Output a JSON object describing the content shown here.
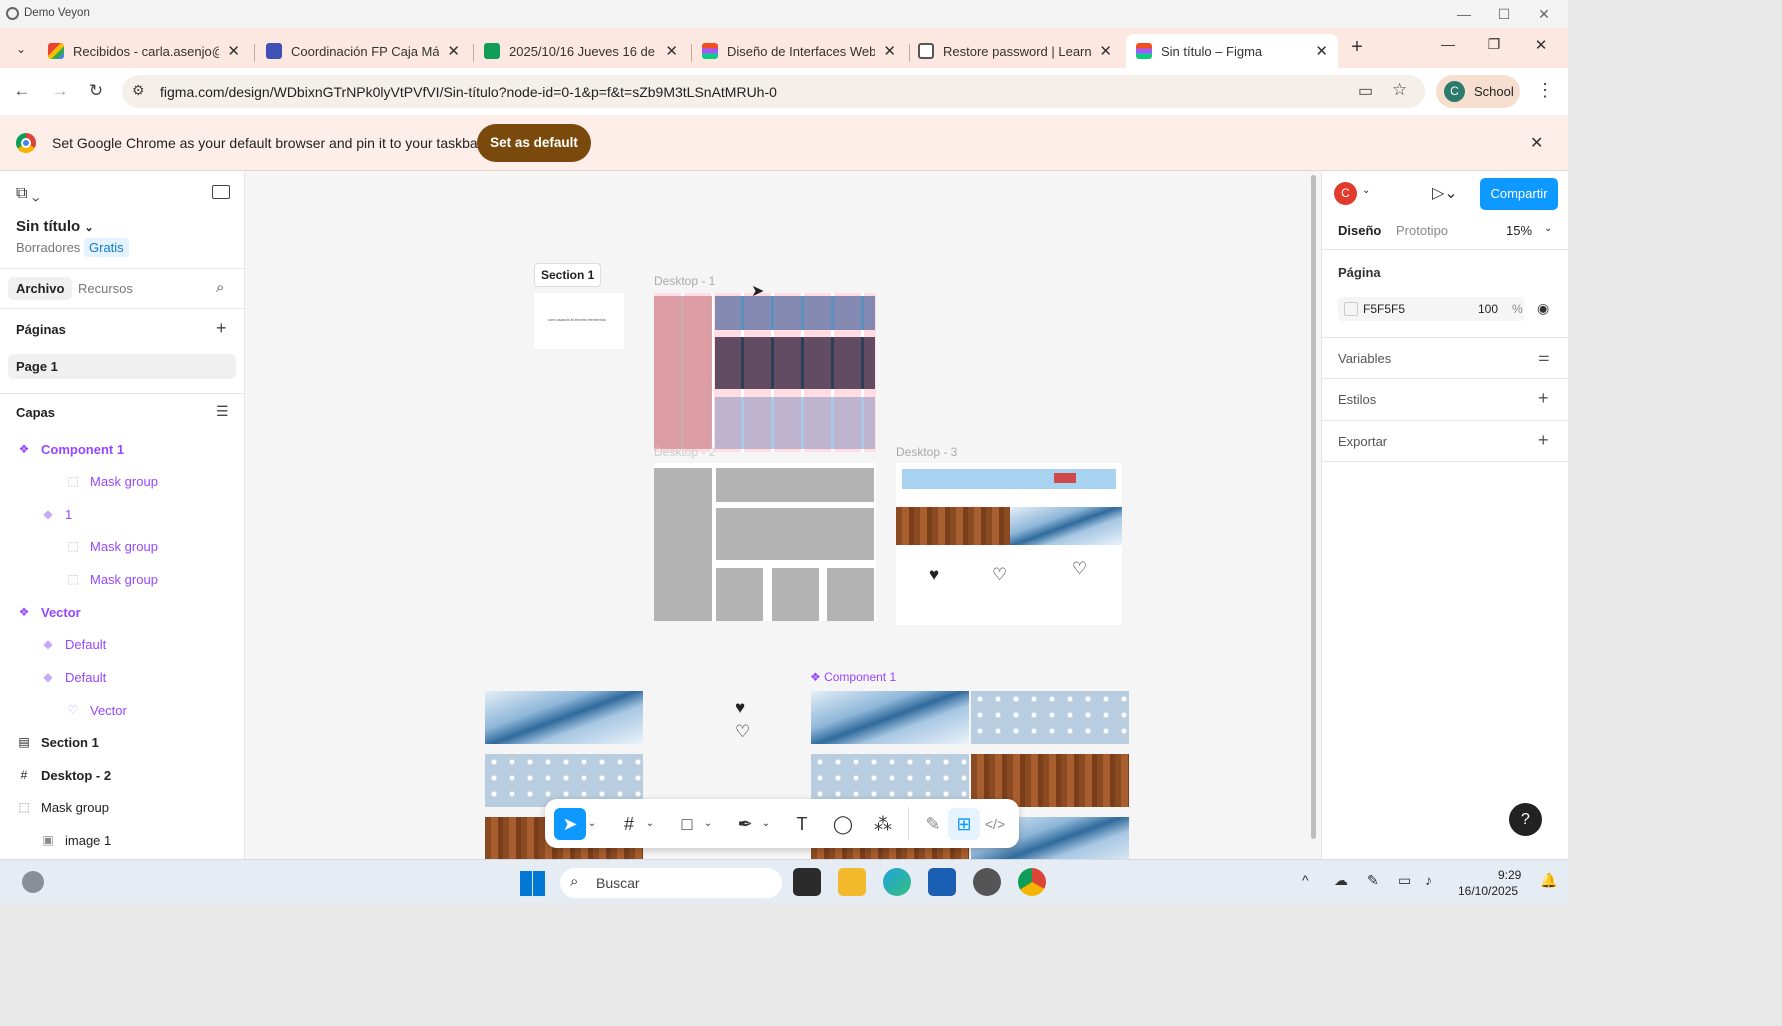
{
  "window": {
    "title": "Demo Veyon"
  },
  "tabs": [
    {
      "label": "Recibidos - carla.asenjo@e",
      "icon": "gmail-icon",
      "color": "#ea4335"
    },
    {
      "label": "Coordinación FP Caja Mág",
      "icon": "forms-icon",
      "color": "#3f51b5"
    },
    {
      "label": "2025/10/16 Jueves 16 de o",
      "icon": "sheets-icon",
      "color": "#0f9d58"
    },
    {
      "label": "Diseño de Interfaces Web -",
      "icon": "figma-icon",
      "color": "#f24e1e"
    },
    {
      "label": "Restore password | Learnin",
      "icon": "page-icon",
      "color": "#555555"
    },
    {
      "label": "Sin título – Figma",
      "icon": "figma-icon",
      "color": "#f24e1e"
    }
  ],
  "address": {
    "url": "figma.com/design/WDbixnGTrNPk0lyVtPVfVI/Sin-título?node-id=0-1&p=f&t=sZb9M3tLSnAtMRUh-0"
  },
  "profile": {
    "initial": "C",
    "name": "School"
  },
  "infobar": {
    "message": "Set Google Chrome as your default browser and pin it to your taskbar",
    "button": "Set as default"
  },
  "left": {
    "file_title": "Sin título",
    "drafts": "Borradores",
    "plan": "Gratis",
    "tab_file": "Archivo",
    "tab_assets": "Recursos",
    "pages_heading": "Páginas",
    "page1": "Page 1",
    "layers_heading": "Capas",
    "layers": [
      {
        "label": "Component 1",
        "icon": "component-icon"
      },
      {
        "label": "Mask group",
        "icon": "mask-icon"
      },
      {
        "label": "1",
        "icon": "instance-icon"
      },
      {
        "label": "Mask group",
        "icon": "mask-icon"
      },
      {
        "label": "Mask group",
        "icon": "mask-icon"
      },
      {
        "label": "Vector",
        "icon": "component-icon"
      },
      {
        "label": "Default",
        "icon": "instance-icon"
      },
      {
        "label": "Default",
        "icon": "instance-icon"
      },
      {
        "label": "Vector",
        "icon": "heart-icon"
      },
      {
        "label": "Section 1",
        "icon": "section-icon"
      },
      {
        "label": "Desktop - 2",
        "icon": "frame-icon"
      },
      {
        "label": "Mask group",
        "icon": "mask-icon"
      },
      {
        "label": "image 1",
        "icon": "image-icon"
      }
    ]
  },
  "canvas": {
    "section_label": "Section 1",
    "section_text": "com.usando.el.theme.elementos",
    "desktop1": "Desktop - 1",
    "desktop2": "Desktop - 2",
    "desktop3": "Desktop - 3",
    "component_label": "Component 1"
  },
  "right": {
    "avatar_initial": "C",
    "share": "Compartir",
    "tab_design": "Diseño",
    "tab_prototype": "Prototipo",
    "zoom": "15%",
    "page_heading": "Página",
    "page_color": "F5F5F5",
    "page_opacity": "100",
    "percent": "%",
    "variables": "Variables",
    "styles": "Estilos",
    "export": "Exportar"
  },
  "taskbar": {
    "search": "Buscar",
    "time": "9:29",
    "date": "16/10/2025"
  },
  "colors": {
    "figma_blue": "#0d99ff",
    "component_purple": "#9747ff",
    "infobar_button": "#7a4a0d"
  }
}
